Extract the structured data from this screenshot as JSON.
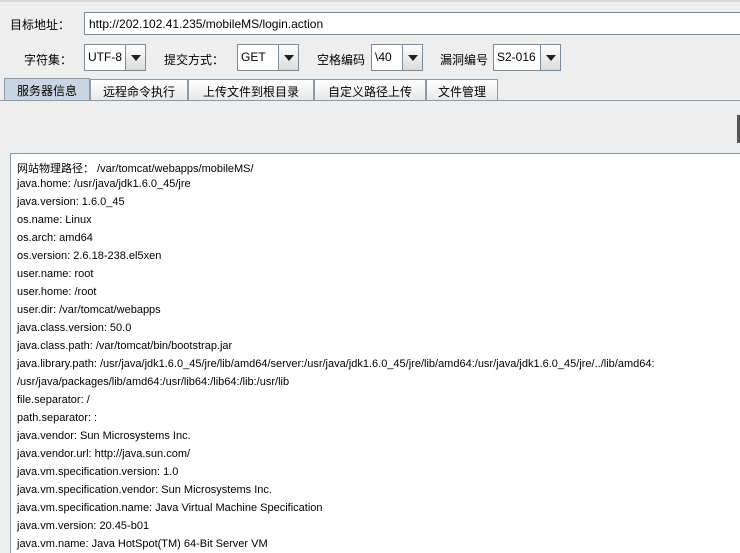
{
  "url_row": {
    "label": "目标地址：",
    "value": "http://202.102.41.235/mobileMS/login.action"
  },
  "options": {
    "charset_label": "字符集：",
    "charset_value": "UTF-8",
    "method_label": "提交方式：",
    "method_value": "GET",
    "space_encoding_label": "空格编码",
    "space_encoding_value": "\\40",
    "vuln_label": "漏洞编号",
    "vuln_value": "S2-016"
  },
  "tabs": [
    {
      "label": "服务器信息",
      "active": true
    },
    {
      "label": "远程命令执行",
      "active": false
    },
    {
      "label": "上传文件到根目录",
      "active": false
    },
    {
      "label": "自定义路径上传",
      "active": false
    },
    {
      "label": "文件管理",
      "active": false
    }
  ],
  "output_lines": [
    "网站物理路径： /var/tomcat/webapps/mobileMS/",
    "java.home: /usr/java/jdk1.6.0_45/jre",
    "java.version: 1.6.0_45",
    "os.name: Linux",
    "os.arch: amd64",
    "os.version: 2.6.18-238.el5xen",
    "user.name: root",
    "user.home: /root",
    "user.dir: /var/tomcat/webapps",
    "java.class.version: 50.0",
    "java.class.path: /var/tomcat/bin/bootstrap.jar",
    "java.library.path: /usr/java/jdk1.6.0_45/jre/lib/amd64/server:/usr/java/jdk1.6.0_45/jre/lib/amd64:/usr/java/jdk1.6.0_45/jre/../lib/amd64:",
    "/usr/java/packages/lib/amd64:/usr/lib64:/lib64:/lib:/usr/lib",
    "file.separator: /",
    "path.separator: :",
    "java.vendor: Sun Microsystems Inc.",
    "java.vendor.url: http://java.sun.com/",
    "java.vm.specification.version: 1.0",
    "java.vm.specification.vendor: Sun Microsystems Inc.",
    "java.vm.specification.name: Java Virtual Machine Specification",
    "java.vm.version: 20.45-b01",
    "java.vm.name: Java HotSpot(TM) 64-Bit Server VM"
  ]
}
